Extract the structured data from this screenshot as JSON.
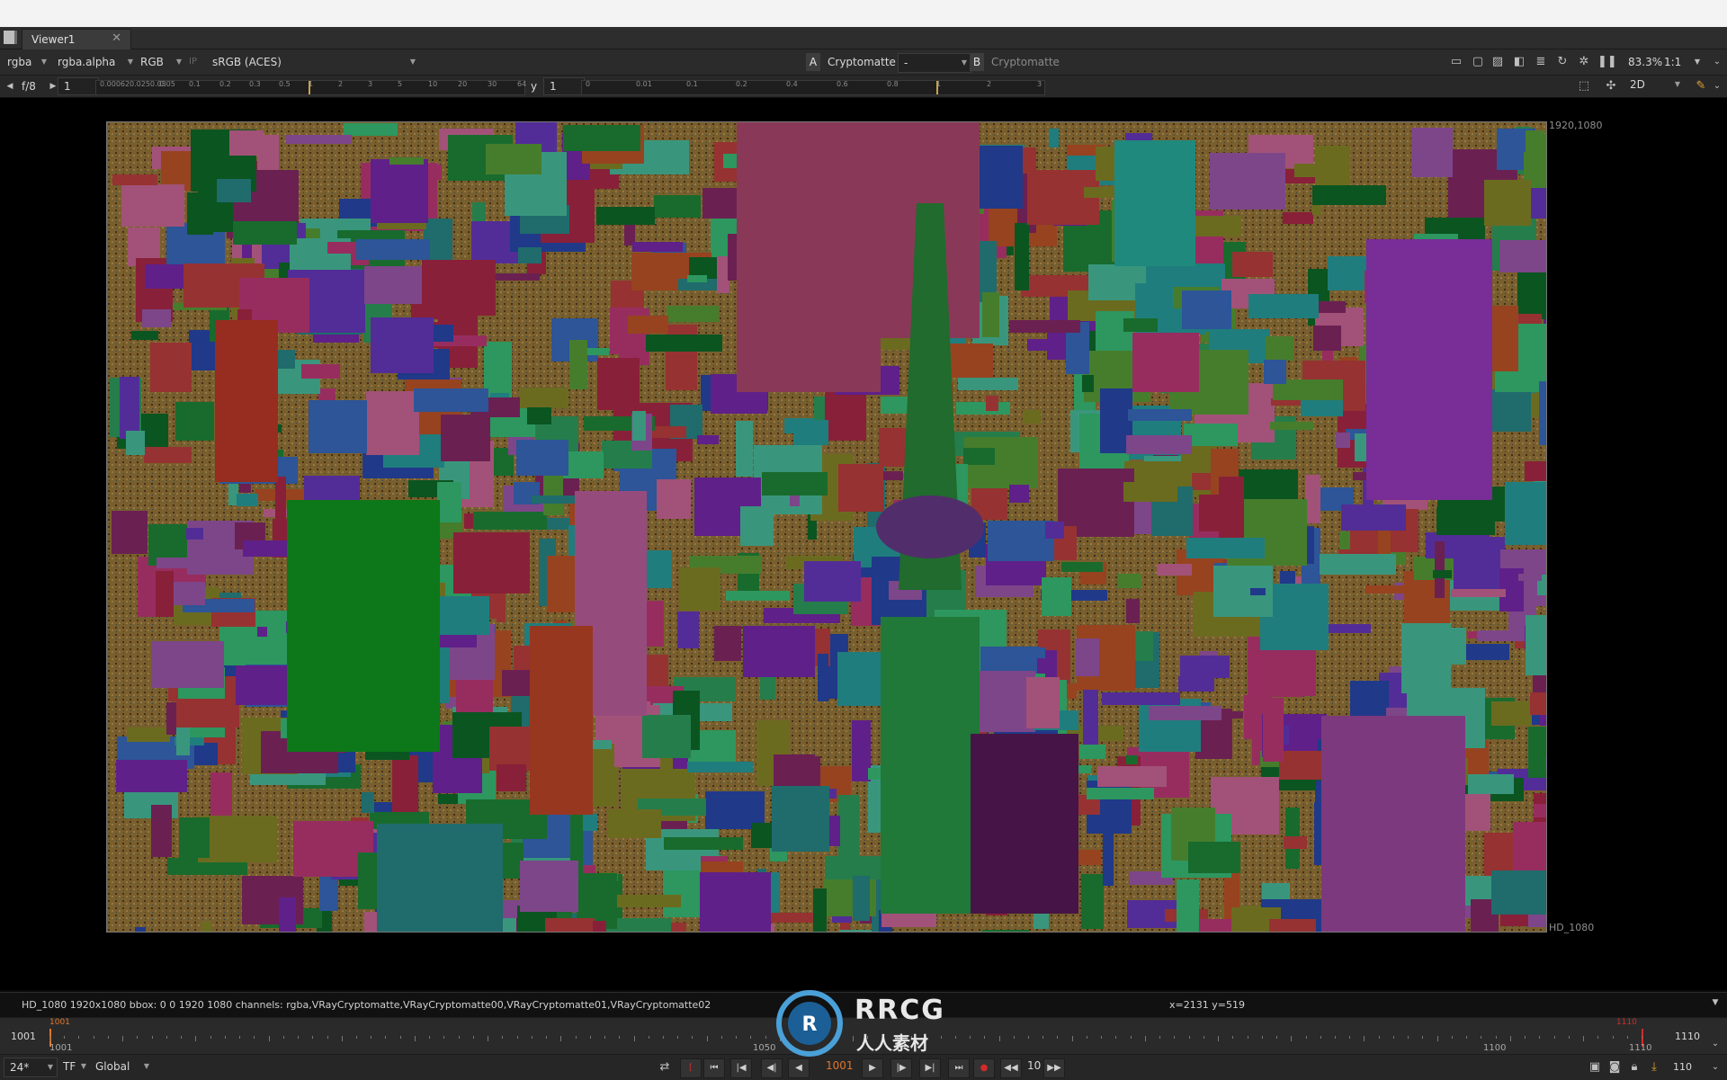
{
  "window": {
    "tab_label": "Viewer1",
    "tab_close": "✕"
  },
  "toolbar1": {
    "channels": "rgba",
    "channel_layer": "rgba.alpha",
    "display_channels": "RGB",
    "ip_label": "IP",
    "colorspace": "sRGB (ACES)",
    "a_label": "A",
    "a_input": "Cryptomatte",
    "a_op": "-",
    "b_label": "B",
    "b_input": "Cryptomatte",
    "zoom": "83.3%",
    "ratio": "1:1"
  },
  "toolbar2": {
    "fstop": "f/8",
    "gain_value": "1",
    "gamma_label": "y",
    "gamma_value": "1",
    "gain_ticks": [
      "0.00062",
      "0.0250.03",
      "0.05",
      "0.1",
      "0.2",
      "0.3",
      "0.5",
      "1",
      "2",
      "3",
      "5",
      "10",
      "20",
      "30",
      "64"
    ],
    "gamma_ticks": [
      "0",
      "0.01",
      "0.1",
      "0.2",
      "0.4",
      "0.6",
      "0.8",
      "1",
      "2",
      "3"
    ],
    "view_mode": "2D"
  },
  "viewer": {
    "format_top_right": "1920,1080",
    "format_bottom_right": "HD_1080"
  },
  "status": {
    "info": "HD_1080 1920x1080  bbox: 0 0 1920 1080 channels: rgba,VRayCryptomatte,VRayCryptomatte00,VRayCryptomatte01,VRayCryptomatte02",
    "coords": "x=2131 y=519"
  },
  "timeline": {
    "start_frame": "1001",
    "end_frame": "1110",
    "playhead_label": "1001",
    "out_marker_label": "1110",
    "frame_labels": [
      "1001",
      "1050",
      "1100",
      "1110"
    ]
  },
  "transport": {
    "fps": "24*",
    "tf_mode": "TF",
    "range_mode": "Global",
    "current_frame": "1001",
    "increment": "10",
    "end_frame": "110"
  },
  "watermark": {
    "logo_text": "RRCG",
    "logo_subtext": "人人素材"
  },
  "colors": {
    "accent_orange": "#e0762b",
    "playhead_red": "#d22b2b",
    "bg_dark": "#2b2b2b"
  }
}
